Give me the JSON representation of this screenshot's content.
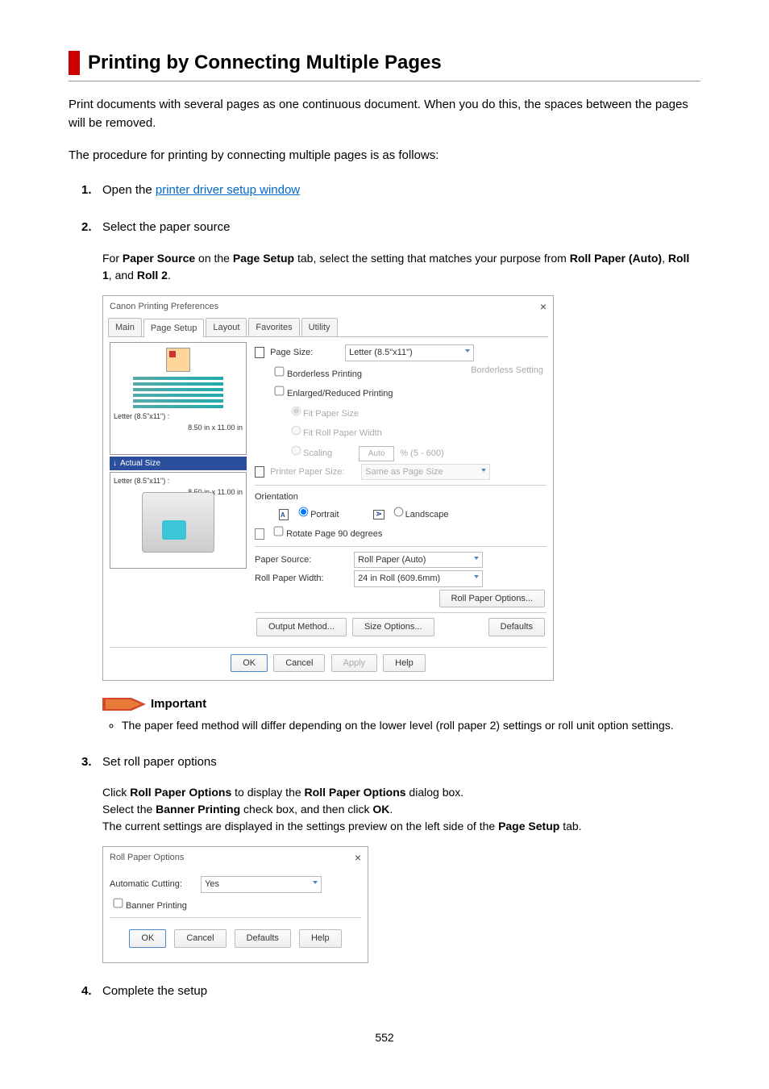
{
  "title": "Printing by Connecting Multiple Pages",
  "intro": "Print documents with several pages as one continuous document. When you do this, the spaces between the pages will be removed.",
  "intro2": "The procedure for printing by connecting multiple pages is as follows:",
  "steps": {
    "s1": {
      "pre": "Open the ",
      "link": "printer driver setup window"
    },
    "s2": {
      "title": "Select the paper source",
      "body_a": "For ",
      "b1": "Paper Source",
      "body_b": " on the ",
      "b2": "Page Setup",
      "body_c": " tab, select the setting that matches your purpose from ",
      "b3": "Roll Paper (Auto)",
      "body_d": ", ",
      "b4": "Roll 1",
      "body_e": ", and ",
      "b5": "Roll 2",
      "body_f": "."
    },
    "s3": {
      "title": "Set roll paper options",
      "c1_a": "Click ",
      "c1_b1": "Roll Paper Options",
      "c1_c": " to display the ",
      "c1_b2": "Roll Paper Options",
      "c1_d": " dialog box.",
      "c2_a": "Select the ",
      "c2_b1": "Banner Printing",
      "c2_b": " check box, and then click ",
      "c2_b2": "OK",
      "c2_c": ".",
      "c3_a": "The current settings are displayed in the settings preview on the left side of the ",
      "c3_b1": "Page Setup",
      "c3_b": " tab."
    },
    "s4": {
      "title": "Complete the setup"
    }
  },
  "important": {
    "label": "Important",
    "note": "The paper feed method will differ depending on the lower level (roll paper 2) settings or roll unit option settings."
  },
  "dlg1": {
    "title": "Canon           Printing Preferences",
    "tabs": [
      "Main",
      "Page Setup",
      "Layout",
      "Favorites",
      "Utility"
    ],
    "page_size_label": "Page Size:",
    "page_size": "Letter (8.5\"x11\")",
    "borderless_printing": "Borderless Printing",
    "borderless_setting": "Borderless Setting",
    "enlarged": "Enlarged/Reduced Printing",
    "fit_paper": "Fit Paper Size",
    "fit_roll": "Fit Roll Paper Width",
    "scaling": "Scaling",
    "scaling_val": "Auto",
    "scaling_hint": "% (5 - 600)",
    "printer_paper_size_label": "Printer Paper Size:",
    "printer_paper_size": "Same as Page Size",
    "orientation_label": "Orientation",
    "portrait": "Portrait",
    "landscape": "Landscape",
    "rotate90": "Rotate Page 90 degrees",
    "paper_source_label": "Paper Source:",
    "paper_source": "Roll Paper (Auto)",
    "roll_width_label": "Roll Paper Width:",
    "roll_width": "24 in Roll (609.6mm)",
    "roll_options": "Roll Paper Options...",
    "output_method": "Output Method...",
    "size_options": "Size Options...",
    "defaults": "Defaults",
    "ok": "OK",
    "cancel": "Cancel",
    "apply": "Apply",
    "help": "Help",
    "preview1": "Letter (8.5\"x11\") :",
    "preview1_dim": "8.50 in x 11.00 in",
    "actual_size": "Actual Size",
    "preview2": "Letter (8.5\"x11\") :",
    "preview2_dim": "8.50 in x 11.00 in"
  },
  "dlg2": {
    "title": "Roll Paper Options",
    "auto_cut_label": "Automatic Cutting:",
    "auto_cut": "Yes",
    "banner": "Banner Printing",
    "ok": "OK",
    "cancel": "Cancel",
    "defaults": "Defaults",
    "help": "Help"
  },
  "page_no": "552"
}
